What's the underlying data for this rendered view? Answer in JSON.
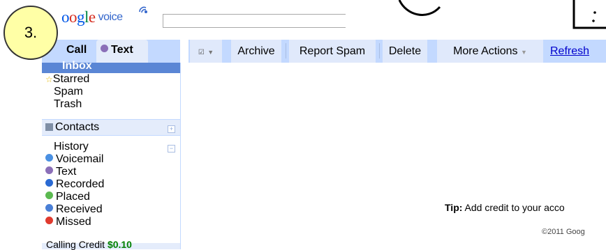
{
  "header": {
    "logo_brand": "Google",
    "logo_product": "voice",
    "search_value": ""
  },
  "badge": {
    "label": "3."
  },
  "tabs": {
    "call": "Call",
    "text": "Text"
  },
  "sidebar": {
    "folders": [
      "Inbox",
      "Starred",
      "Spam",
      "Trash"
    ],
    "contacts": "Contacts",
    "history": "History",
    "history_items": [
      {
        "label": "Voicemail",
        "color": "#4a90e2"
      },
      {
        "label": "Text",
        "color": "#8b6fb8"
      },
      {
        "label": "Recorded",
        "color": "#2a6ad3"
      },
      {
        "label": "Placed",
        "color": "#5bb950"
      },
      {
        "label": "Received",
        "color": "#4a7fd6"
      },
      {
        "label": "Missed",
        "color": "#e03a2e"
      }
    ],
    "credit_label": "Calling Credit",
    "credit_amount": "$0.10"
  },
  "toolbar": {
    "archive": "Archive",
    "report_spam": "Report Spam",
    "delete": "Delete",
    "more_actions": "More Actions",
    "refresh": "Refresh"
  },
  "footer": {
    "tip_label": "Tip:",
    "tip_text": "Add credit to your acco",
    "copyright": "©2011 Goog"
  },
  "colors": {
    "toolbar_bg": "#c3d9ff",
    "selected_bg": "#5a86d5",
    "link": "#0000cc"
  }
}
